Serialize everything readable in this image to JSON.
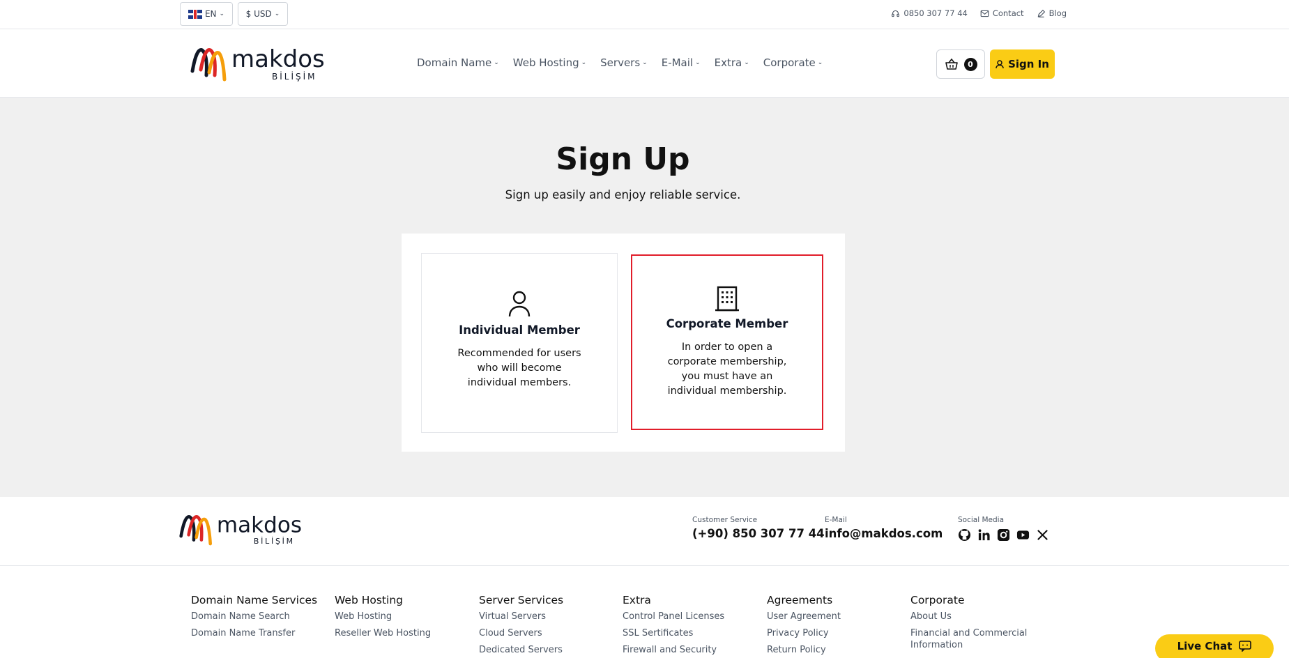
{
  "topbar": {
    "language": "EN",
    "currency": "$ USD",
    "phone": "0850 307 77 44",
    "contact": "Contact",
    "blog": "Blog"
  },
  "header": {
    "logo_text": "makdos",
    "logo_sub": "BİLİŞİM",
    "nav": [
      "Domain Name",
      "Web Hosting",
      "Servers",
      "E-Mail",
      "Extra",
      "Corporate"
    ],
    "cart_count": "0",
    "signin_label": "Sign In"
  },
  "main": {
    "title": "Sign Up",
    "subtitle": "Sign up easily and enjoy reliable service.",
    "individual": {
      "title": "Individual Member",
      "description": "Recommended for users who will become individual members."
    },
    "corporate": {
      "title": "Corporate Member",
      "description": "In order to open a corporate membership, you must have an individual membership."
    }
  },
  "footer": {
    "customer_service_label": "Customer Service",
    "customer_service_value": "(+90) 850 307 77 44",
    "email_label": "E-Mail",
    "email_value": "info@makdos.com",
    "social_label": "Social Media",
    "social_icons": [
      "github-icon",
      "linkedin-icon",
      "instagram-icon",
      "youtube-icon",
      "x-icon"
    ],
    "columns": [
      {
        "title": "Domain Name Services",
        "links": [
          "Domain Name Search",
          "Domain Name Transfer"
        ]
      },
      {
        "title": "Web Hosting",
        "links": [
          "Web Hosting",
          "Reseller Web Hosting"
        ]
      },
      {
        "title": "Server Services",
        "links": [
          "Virtual Servers",
          "Cloud Servers",
          "Dedicated Servers"
        ]
      },
      {
        "title": "Extra",
        "links": [
          "Control Panel Licenses",
          "SSL Sertificates",
          "Firewall and Security"
        ]
      },
      {
        "title": "Agreements",
        "links": [
          "User Agreement",
          "Privacy Policy",
          "Return Policy"
        ]
      },
      {
        "title": "Corporate",
        "links": [
          "About Us",
          "Financial and Commercial Information"
        ]
      }
    ]
  },
  "livechat_label": "Live Chat",
  "colors": {
    "accent_yellow": "#facc15",
    "highlight_red": "#e11d2a",
    "background_gray": "#f0f0f0"
  }
}
